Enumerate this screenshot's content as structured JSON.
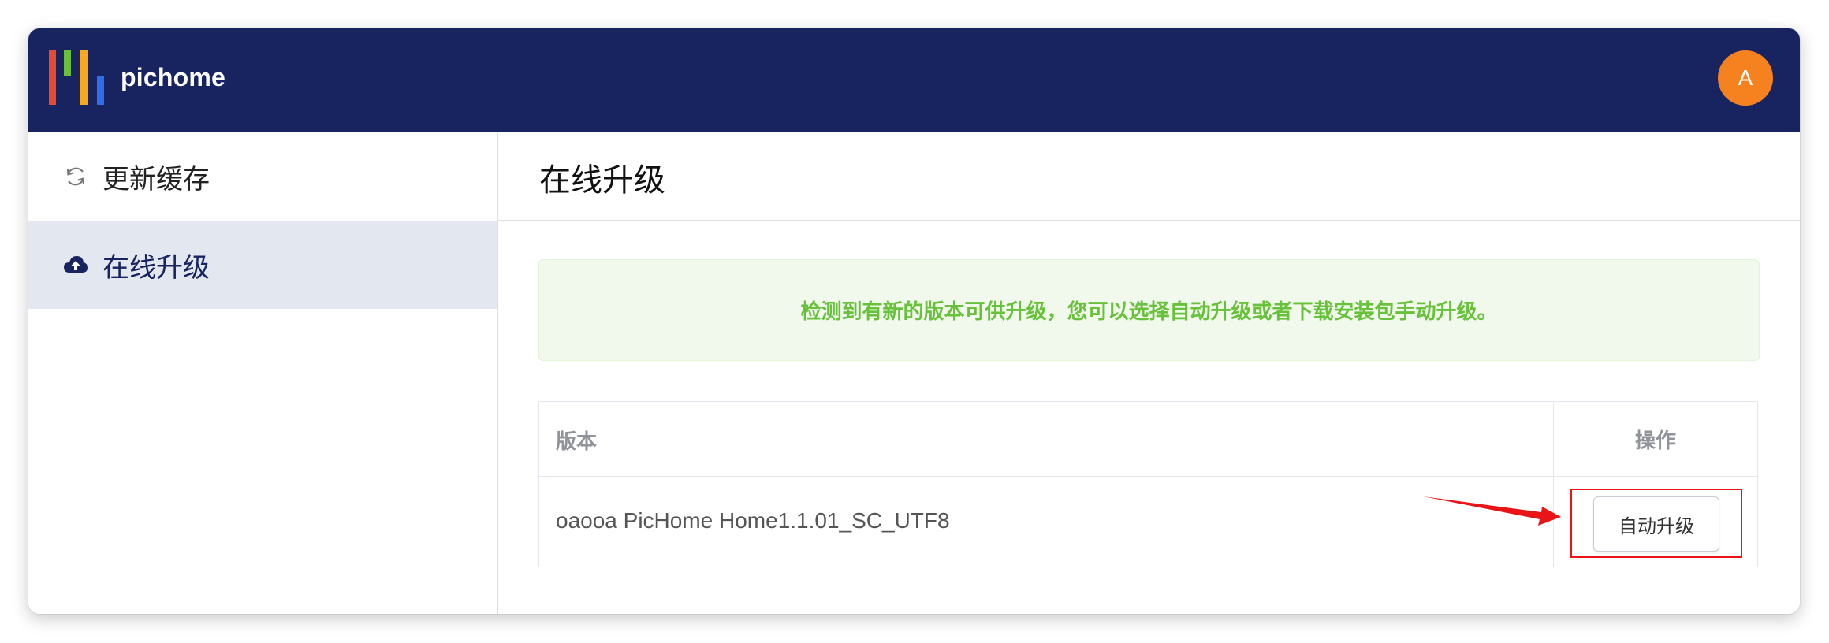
{
  "header": {
    "app_name": "pichome",
    "avatar_letter": "A",
    "background": "#172460",
    "logo_colors": [
      "#e8492f",
      "#6cbf3a",
      "#f6a821",
      "#2f6ee8"
    ]
  },
  "sidebar": {
    "items": [
      {
        "label": "更新缓存",
        "icon": "refresh-icon",
        "active": false
      },
      {
        "label": "在线升级",
        "icon": "cloud-upload-icon",
        "active": true
      }
    ]
  },
  "main": {
    "title": "在线升级",
    "alert": {
      "text": "检测到有新的版本可供升级，您可以选择自动升级或者下载安装包手动升级。",
      "color": "#67c23a"
    },
    "table": {
      "columns": [
        "版本",
        "操作"
      ],
      "rows": [
        {
          "version": "oaooa PicHome Home1.1.01_SC_UTF8",
          "action_label": "自动升级"
        }
      ]
    }
  },
  "annotation": {
    "color": "#e81416"
  }
}
